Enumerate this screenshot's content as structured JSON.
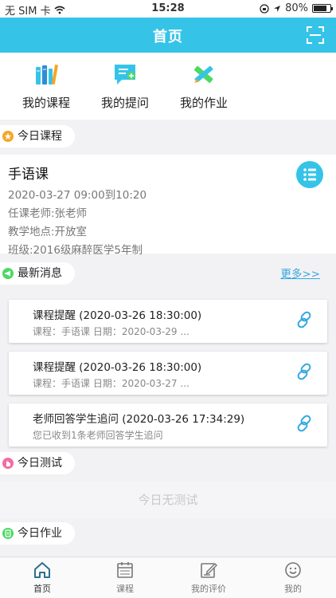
{
  "status_bar": {
    "carrier": "无 SIM 卡",
    "time": "15:28",
    "battery": "80%",
    "battery_level": 0.8
  },
  "nav": {
    "title": "首页",
    "scan_icon": "scan-icon"
  },
  "quick_links": [
    {
      "label": "我的课程",
      "icon": "books-icon"
    },
    {
      "label": "我的提问",
      "icon": "question-chat-icon"
    },
    {
      "label": "我的作业",
      "icon": "pencil-ruler-icon"
    }
  ],
  "today_course": {
    "section_label": "今日课程",
    "name": "手语课",
    "time": "2020-03-27  09:00到10:20",
    "teacher": "任课老师:张老师",
    "location": "教学地点:开放室",
    "class": "班级:2016级麻醉医学5年制"
  },
  "news": {
    "section_label": "最新消息",
    "more_label": "更多>>",
    "items": [
      {
        "title": "课程提醒  (2020-03-26 18:30:00)",
        "subtitle": "课程：手语课 日期：2020-03-29 ..."
      },
      {
        "title": "课程提醒  (2020-03-26 18:30:00)",
        "subtitle": "课程：手语课 日期：2020-03-27 ..."
      },
      {
        "title": "老师回答学生追问  (2020-03-26 17:34:29)",
        "subtitle": "您已收到1条老师回答学生追问"
      }
    ]
  },
  "today_test": {
    "section_label": "今日测试",
    "empty_text": "今日无测试"
  },
  "today_homework": {
    "section_label": "今日作业"
  },
  "tabs": [
    {
      "label": "首页",
      "icon": "home-icon",
      "active": true
    },
    {
      "label": "课程",
      "icon": "calendar-icon",
      "active": false
    },
    {
      "label": "我的评价",
      "icon": "edit-note-icon",
      "active": false
    },
    {
      "label": "我的",
      "icon": "smiley-icon",
      "active": false
    }
  ],
  "colors": {
    "brand": "#35c4e8",
    "link": "#35a8e0",
    "star_tag": "#f5a623",
    "news_tag": "#4cd964",
    "test_tag": "#f06fa4",
    "homework_tag": "#4cd964"
  }
}
